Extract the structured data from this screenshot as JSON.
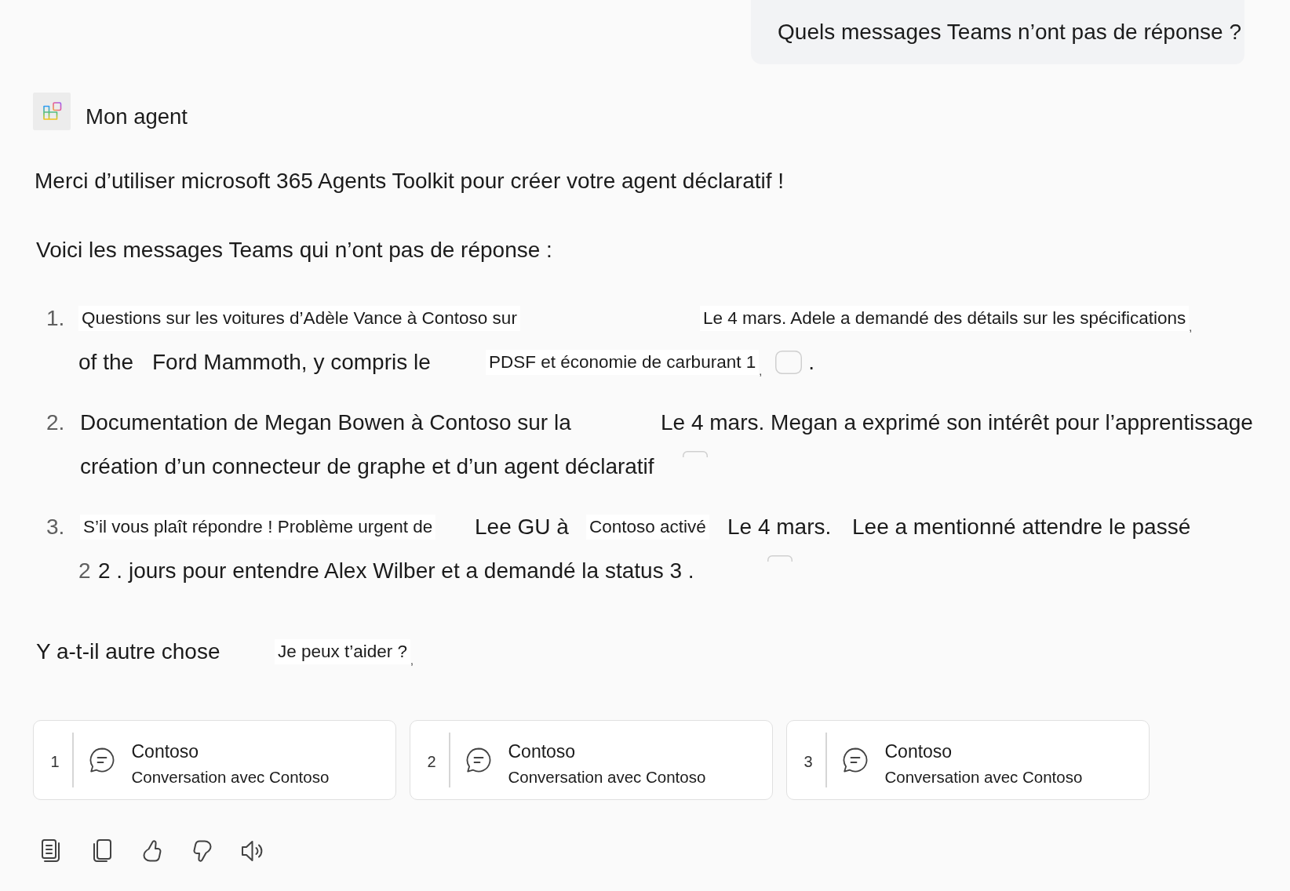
{
  "user_message": {
    "text": "Quels messages Teams n’ont pas de réponse ?"
  },
  "agent": {
    "name": "Mon agent"
  },
  "response": {
    "intro": "Merci d’utiliser microsoft 365 Agents Toolkit pour créer votre agent déclaratif !",
    "lead": "Voici les messages Teams qui n’ont pas de réponse :",
    "items": [
      {
        "number": "1.",
        "lines": [
          {
            "segments": [
              {
                "kind": "overlay",
                "text": "Questions sur les voitures d’Adèle Vance à Contoso sur"
              },
              {
                "kind": "overlay",
                "text": "Le 4 mars. Adele a demandé des détails sur les spécifications"
              },
              {
                "kind": "tiny",
                "text": ","
              }
            ]
          },
          {
            "segments": [
              {
                "kind": "text",
                "text": "of the"
              },
              {
                "kind": "text",
                "text": "Ford Mammoth, y compris le"
              },
              {
                "kind": "overlay",
                "text": "PDSF et économie de carburant 1"
              },
              {
                "kind": "tiny",
                "text": ","
              },
              {
                "kind": "pill"
              },
              {
                "kind": "text",
                "text": "."
              }
            ]
          }
        ]
      },
      {
        "number": "2.",
        "lines": [
          {
            "segments": [
              {
                "kind": "text",
                "text": "Documentation de Megan Bowen à Contoso sur la"
              },
              {
                "kind": "text",
                "text": "Le 4 mars. Megan a exprimé son intérêt pour l’apprentissage"
              }
            ]
          },
          {
            "segments": [
              {
                "kind": "text",
                "text": "création d’un connecteur de graphe et d’un agent déclaratif"
              },
              {
                "kind": "pill_top"
              }
            ]
          }
        ]
      },
      {
        "number": "3.",
        "lines": [
          {
            "segments": [
              {
                "kind": "overlay",
                "text": "S’il vous plaît répondre ! Problème urgent de"
              },
              {
                "kind": "text",
                "text": "Lee GU à"
              },
              {
                "kind": "overlay",
                "text": "Contoso activé"
              },
              {
                "kind": "text",
                "text": "Le 4 mars."
              },
              {
                "kind": "text",
                "text": "Lee a mentionné attendre le passé"
              }
            ]
          },
          {
            "segments": [
              {
                "kind": "numeral",
                "text": "2"
              },
              {
                "kind": "text",
                "text": "2 . jours pour entendre Alex Wilber et a demandé la status 3 ."
              },
              {
                "kind": "pill_top"
              }
            ]
          }
        ]
      }
    ],
    "closing": {
      "segments": [
        {
          "kind": "text",
          "text": "Y a-t-il autre chose"
        },
        {
          "kind": "overlay",
          "text": "Je peux t’aider ?"
        },
        {
          "kind": "tiny",
          "text": ","
        }
      ]
    }
  },
  "citations": [
    {
      "number": "1",
      "title": "Contoso",
      "subtitle": "Conversation avec Contoso"
    },
    {
      "number": "2",
      "title": "Contoso",
      "subtitle": "Conversation avec Contoso"
    },
    {
      "number": "3",
      "title": "Contoso",
      "subtitle": "Conversation avec Contoso"
    }
  ]
}
